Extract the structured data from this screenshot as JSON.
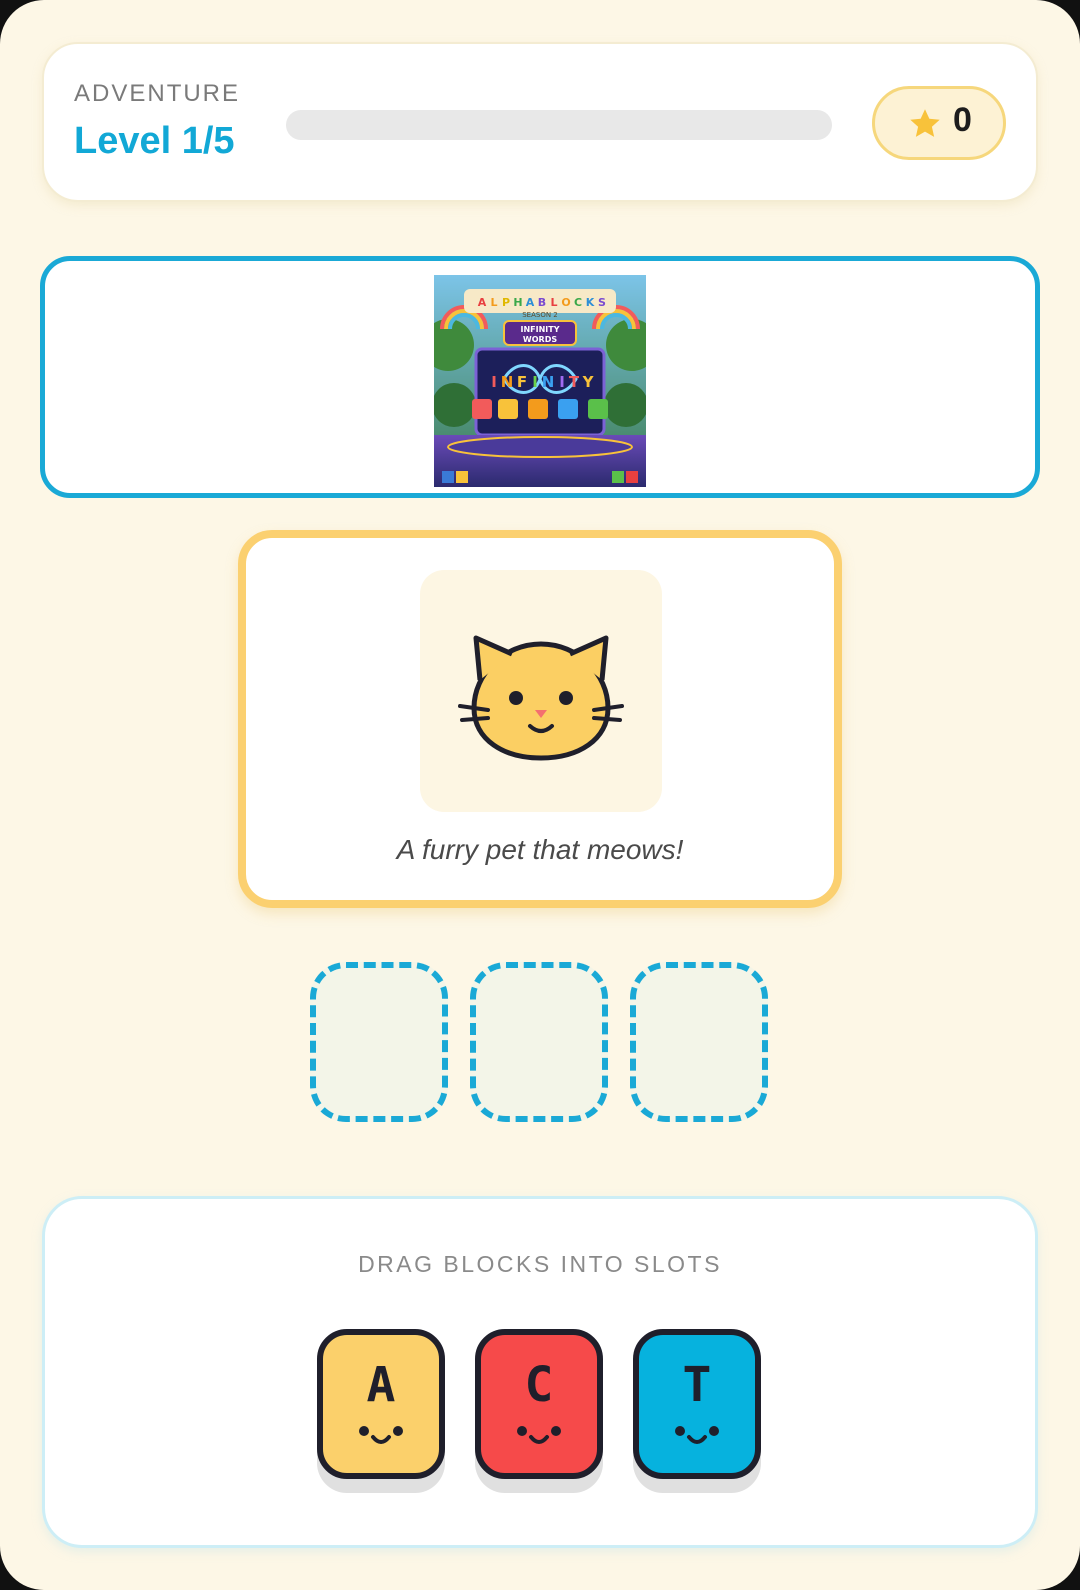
{
  "header": {
    "mode_label": "ADVENTURE",
    "level_label": "Level 1/5",
    "progress_fraction": 0,
    "stars_count": "0",
    "star_icon": "star-icon"
  },
  "banner": {
    "art_icon": "alphablocks-infinity-words-banner"
  },
  "clue": {
    "picture_icon": "cat-icon",
    "text": "A furry pet that meows!"
  },
  "slots": [
    {
      "letter": ""
    },
    {
      "letter": ""
    },
    {
      "letter": ""
    }
  ],
  "tray": {
    "label": "DRAG BLOCKS INTO SLOTS",
    "blocks": [
      {
        "letter": "A",
        "color": "#fbd06b"
      },
      {
        "letter": "C",
        "color": "#f64a4a"
      },
      {
        "letter": "T",
        "color": "#06b2de"
      }
    ]
  },
  "colors": {
    "accent": "#1aa9d6",
    "background": "#fdf7e6",
    "card_border": "#fbd070"
  }
}
